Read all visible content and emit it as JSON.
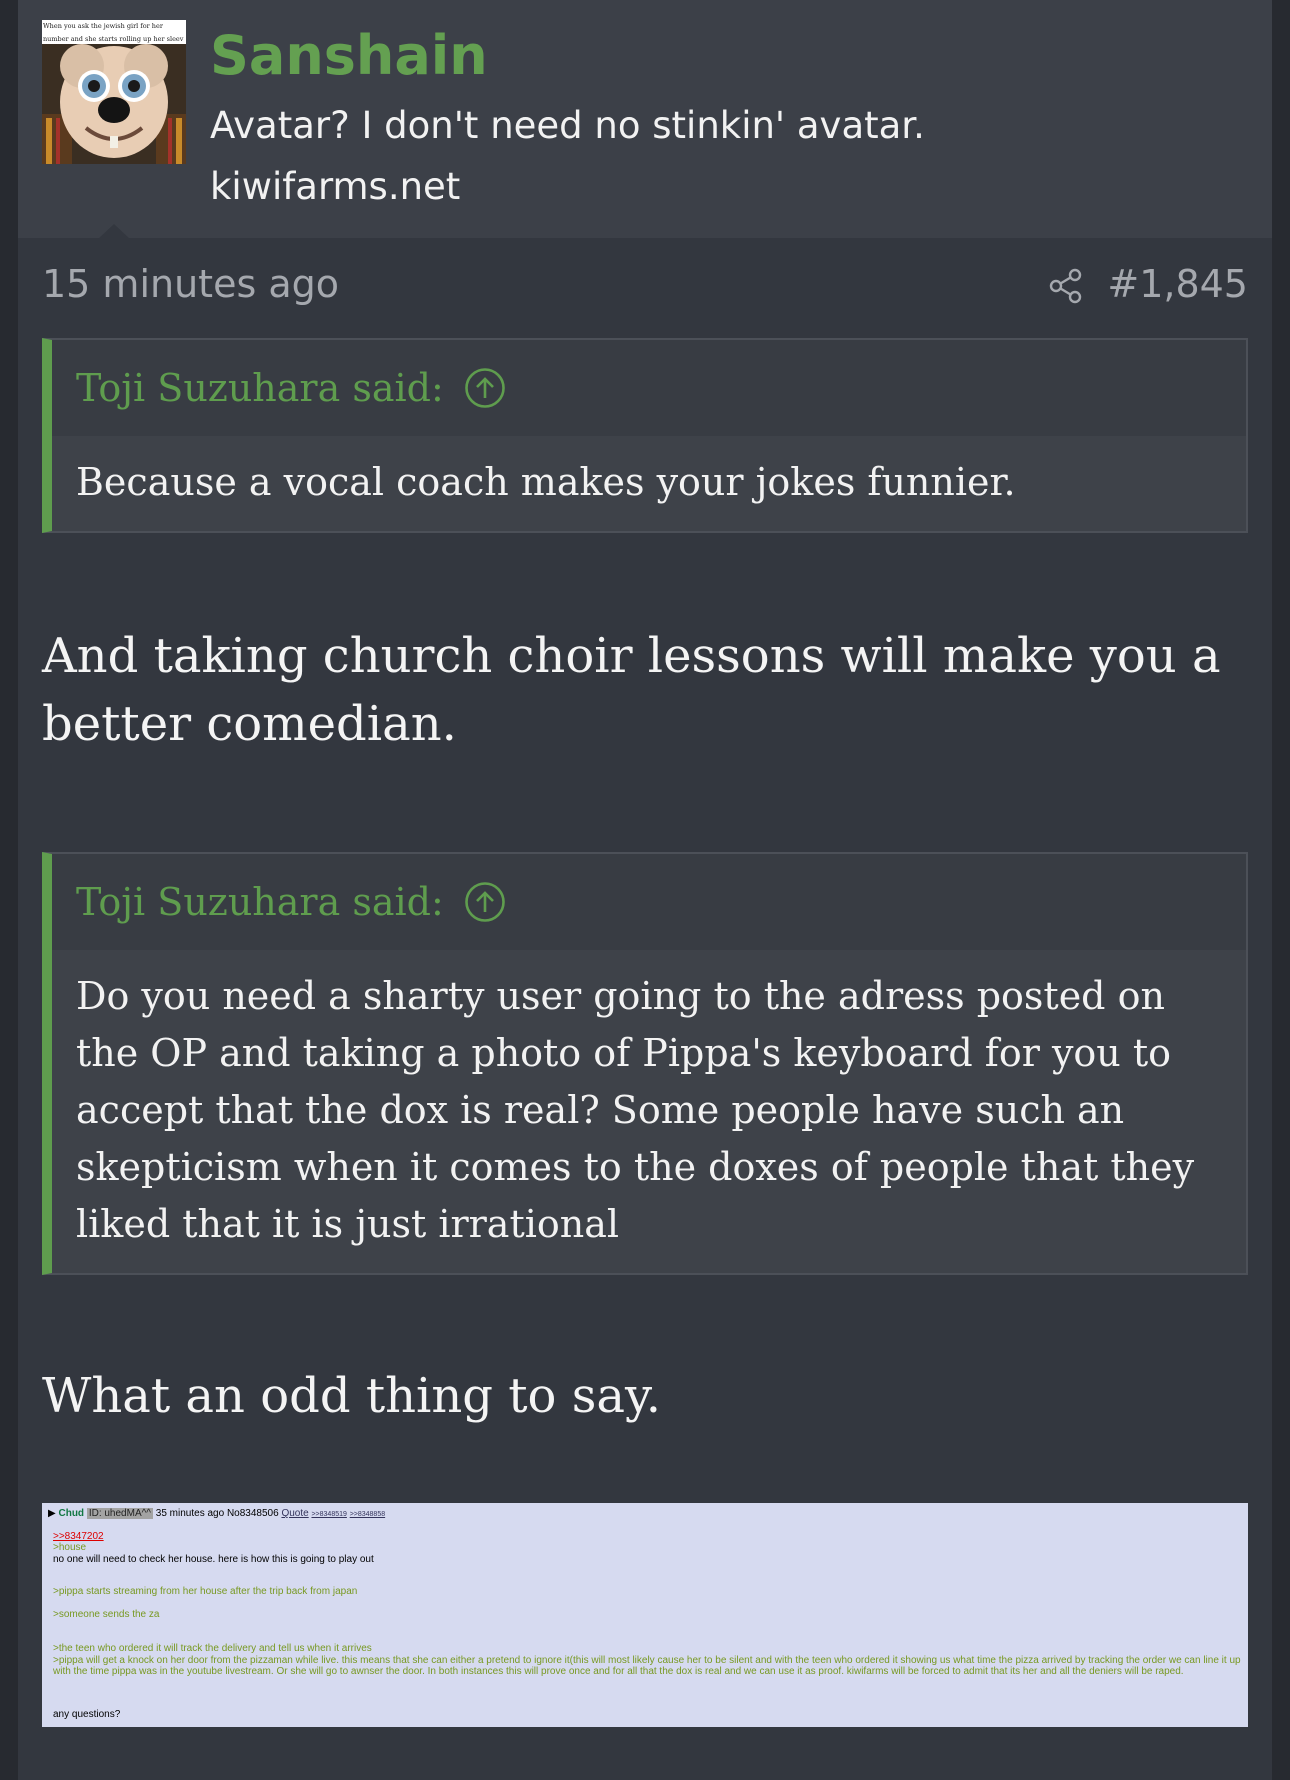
{
  "user": {
    "name": "Sanshain",
    "title": "Avatar? I don't need no stinkin' avatar.",
    "site": "kiwifarms.net",
    "avatar_caption": "When you ask the jewish girl for her number and she starts rolling up her sleev"
  },
  "meta": {
    "time": "15 minutes ago",
    "post_number": "#1,845"
  },
  "quotes": [
    {
      "author": "Toji Suzuhara said:",
      "body": "Because a vocal coach makes your jokes funnier."
    },
    {
      "author": "Toji Suzuhara said:",
      "body": "Do you need a sharty user going to the adress posted on the OP and taking a photo of Pippa's keyboard for you to accept that the dox is real? Some people have such an skepticism when it comes to the doxes of people that they liked that it is just irrational"
    }
  ],
  "messages": [
    "And taking church choir lessons will make you a better comedian.",
    "What an odd thing to say."
  ],
  "attachment": {
    "marker": "▶",
    "name": "Chud",
    "id": "ID: uhedMA^^",
    "time": "35 minutes ago No8348506",
    "quote_link": "Quote",
    "reply1": ">>8348519",
    "reply2": ">>8348858",
    "line_ref": ">>8347202",
    "line_house": ">house",
    "line_1": "no one will need to check her house. here is how this is going to play out",
    "line_2": ">pippa starts streaming from her house after the trip back from japan",
    "line_3": ">someone sends the za",
    "line_4": ">the teen who ordered it will track the delivery and tell us when it arrives",
    "line_5": ">pippa will get a knock on her door from the pizzaman while live. this means that she can either a pretend to ignore it(this will most likely cause her to be silent and with the teen who ordered it showing us what time the pizza arrived by tracking the order we can line it up with the time pippa was in the youtube livestream. Or she will go to awnser the door. In both instances this will prove once and for all that the dox is real and we can use it as proof. kiwifarms will be forced to admit that its her and all the deniers will be raped.",
    "line_6": "any questions?"
  },
  "colors": {
    "accent_green": "#64a051",
    "background": "#33373f",
    "header_bg": "#3c4048"
  },
  "icons": [
    "share-icon",
    "arrow-up-circle-icon"
  ]
}
